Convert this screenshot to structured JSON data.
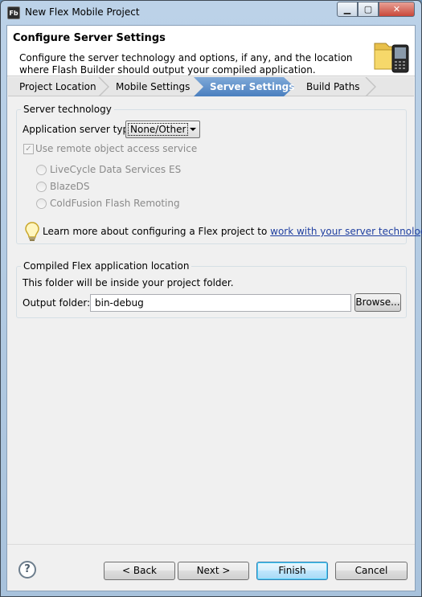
{
  "window": {
    "icon_text": "Fb",
    "title": "New Flex Mobile Project",
    "minimize_glyph": "▁",
    "maximize_glyph": "▢",
    "close_glyph": "✕"
  },
  "header": {
    "title": "Configure Server Settings",
    "description": "Configure the server technology and options, if any, and the location where Flash Builder should output your compiled application."
  },
  "steps": [
    {
      "label": "Project Location",
      "active": false
    },
    {
      "label": "Mobile Settings",
      "active": false
    },
    {
      "label": "Server Settings",
      "active": true
    },
    {
      "label": "Build Paths",
      "active": false
    }
  ],
  "server_technology": {
    "group_label": "Server technology",
    "type_label": "Application server type:",
    "type_value": "None/Other",
    "remote_checkbox_label": "Use remote object access service",
    "remote_checked": true,
    "options": [
      "LiveCycle Data Services ES",
      "BlazeDS",
      "ColdFusion Flash Remoting"
    ],
    "info_text": "Learn more about configuring a Flex project to ",
    "info_link": "work with your server technology",
    "info_suffix": "."
  },
  "output": {
    "group_label": "Compiled Flex application location",
    "note": "This folder will be inside your project folder.",
    "folder_label": "Output folder:",
    "folder_value": "bin-debug",
    "browse_label": "Browse..."
  },
  "footer": {
    "help_glyph": "?",
    "back_label": "< Back",
    "next_label": "Next >",
    "finish_label": "Finish",
    "cancel_label": "Cancel"
  },
  "colors": {
    "active_step": "#4a7fbf",
    "link": "#1f3fa0",
    "default_button": "#3c7fb1"
  }
}
